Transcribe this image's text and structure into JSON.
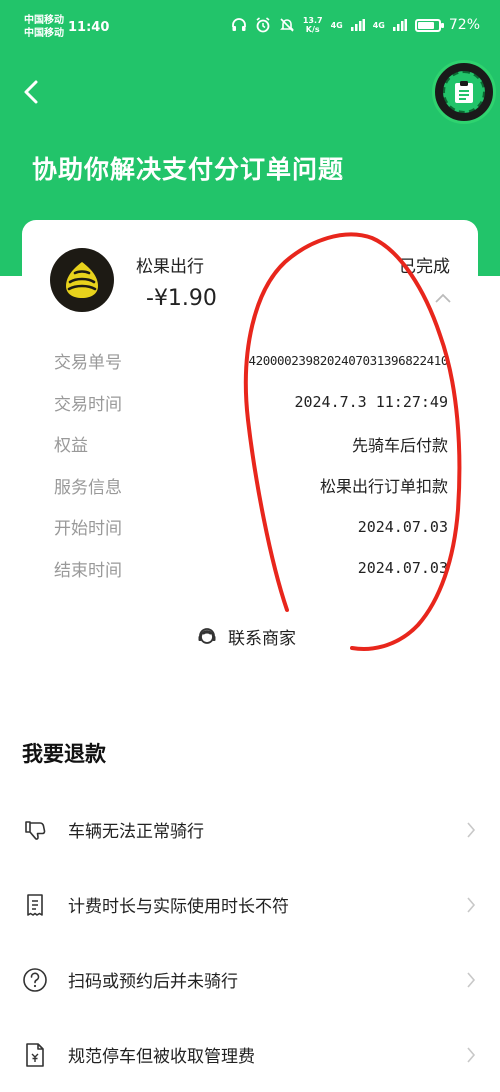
{
  "status_bar": {
    "carrier_1": "中国移动",
    "carrier_2": "中国移动",
    "time": "11:40",
    "speed_value": "13.7",
    "speed_unit": "K/s",
    "net_1": "4G",
    "net_2": "4G",
    "battery_percent": "72%",
    "battery_level": 0.72
  },
  "header": {
    "title": "协助你解决支付分订单问题"
  },
  "order": {
    "merchant": "松果出行",
    "amount": "-¥1.90",
    "status": "已完成",
    "details": [
      {
        "key": "交易单号",
        "value": "4200002398202407031396822410"
      },
      {
        "key": "交易时间",
        "value": "2024.7.3 11:27:49"
      },
      {
        "key": "权益",
        "value": "先骑车后付款"
      },
      {
        "key": "服务信息",
        "value": "松果出行订单扣款"
      },
      {
        "key": "开始时间",
        "value": "2024.07.03"
      },
      {
        "key": "结束时间",
        "value": "2024.07.03"
      }
    ],
    "contact_label": "联系商家"
  },
  "refund": {
    "title": "我要退款",
    "items": [
      {
        "label": "车辆无法正常骑行",
        "icon": "thumbs-down-icon"
      },
      {
        "label": "计费时长与实际使用时长不符",
        "icon": "receipt-icon"
      },
      {
        "label": "扫码或预约后并未骑行",
        "icon": "question-icon"
      },
      {
        "label": "规范停车但被收取管理费",
        "icon": "yuan-document-icon"
      }
    ]
  },
  "colors": {
    "brand_green": "#22c46a",
    "annotation_red": "#e8261c"
  }
}
